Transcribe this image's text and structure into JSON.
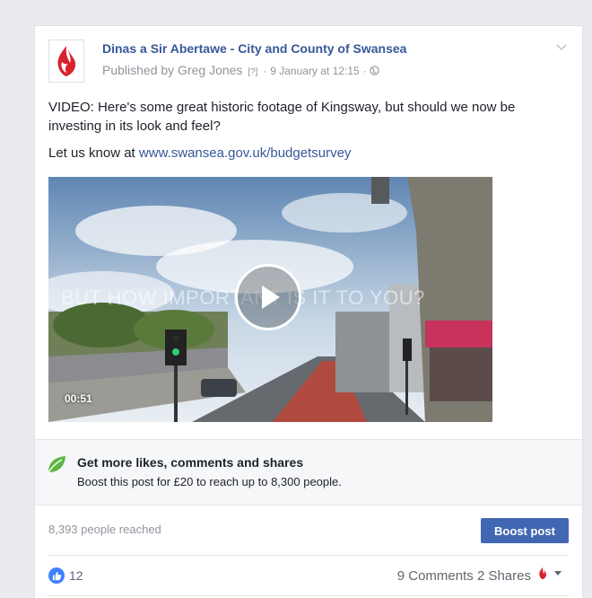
{
  "post": {
    "page_name": "Dinas a Sir Abertawe - City and County of Swansea",
    "published_prefix": "Published by Greg Jones",
    "help_marker": "[?]",
    "separator": "·",
    "date": "9 January at 12:15",
    "privacy_icon": "globe-icon",
    "text_line1": "VIDEO: Here's some great historic footage of Kingsway, but should we now be investing in its look and feel?",
    "text_line2_prefix": "Let us know at ",
    "link": "www.swansea.gov.uk/budgetsurvey"
  },
  "video": {
    "overlay_text": "BUT HOW IMPORTANT IS IT TO YOU?",
    "duration": "00:51"
  },
  "promo": {
    "title": "Get more likes, comments and shares",
    "subtitle": "Boost this post for £20 to reach up to 8,300 people."
  },
  "insights": {
    "reach": "8,393 people reached",
    "boost_label": "Boost post"
  },
  "engagement": {
    "likes": "12",
    "comments": "9 Comments",
    "shares": "2 Shares"
  },
  "colors": {
    "link": "#365899",
    "button": "#4267b2",
    "like": "#4080ff",
    "brand_red": "#d9232d"
  }
}
